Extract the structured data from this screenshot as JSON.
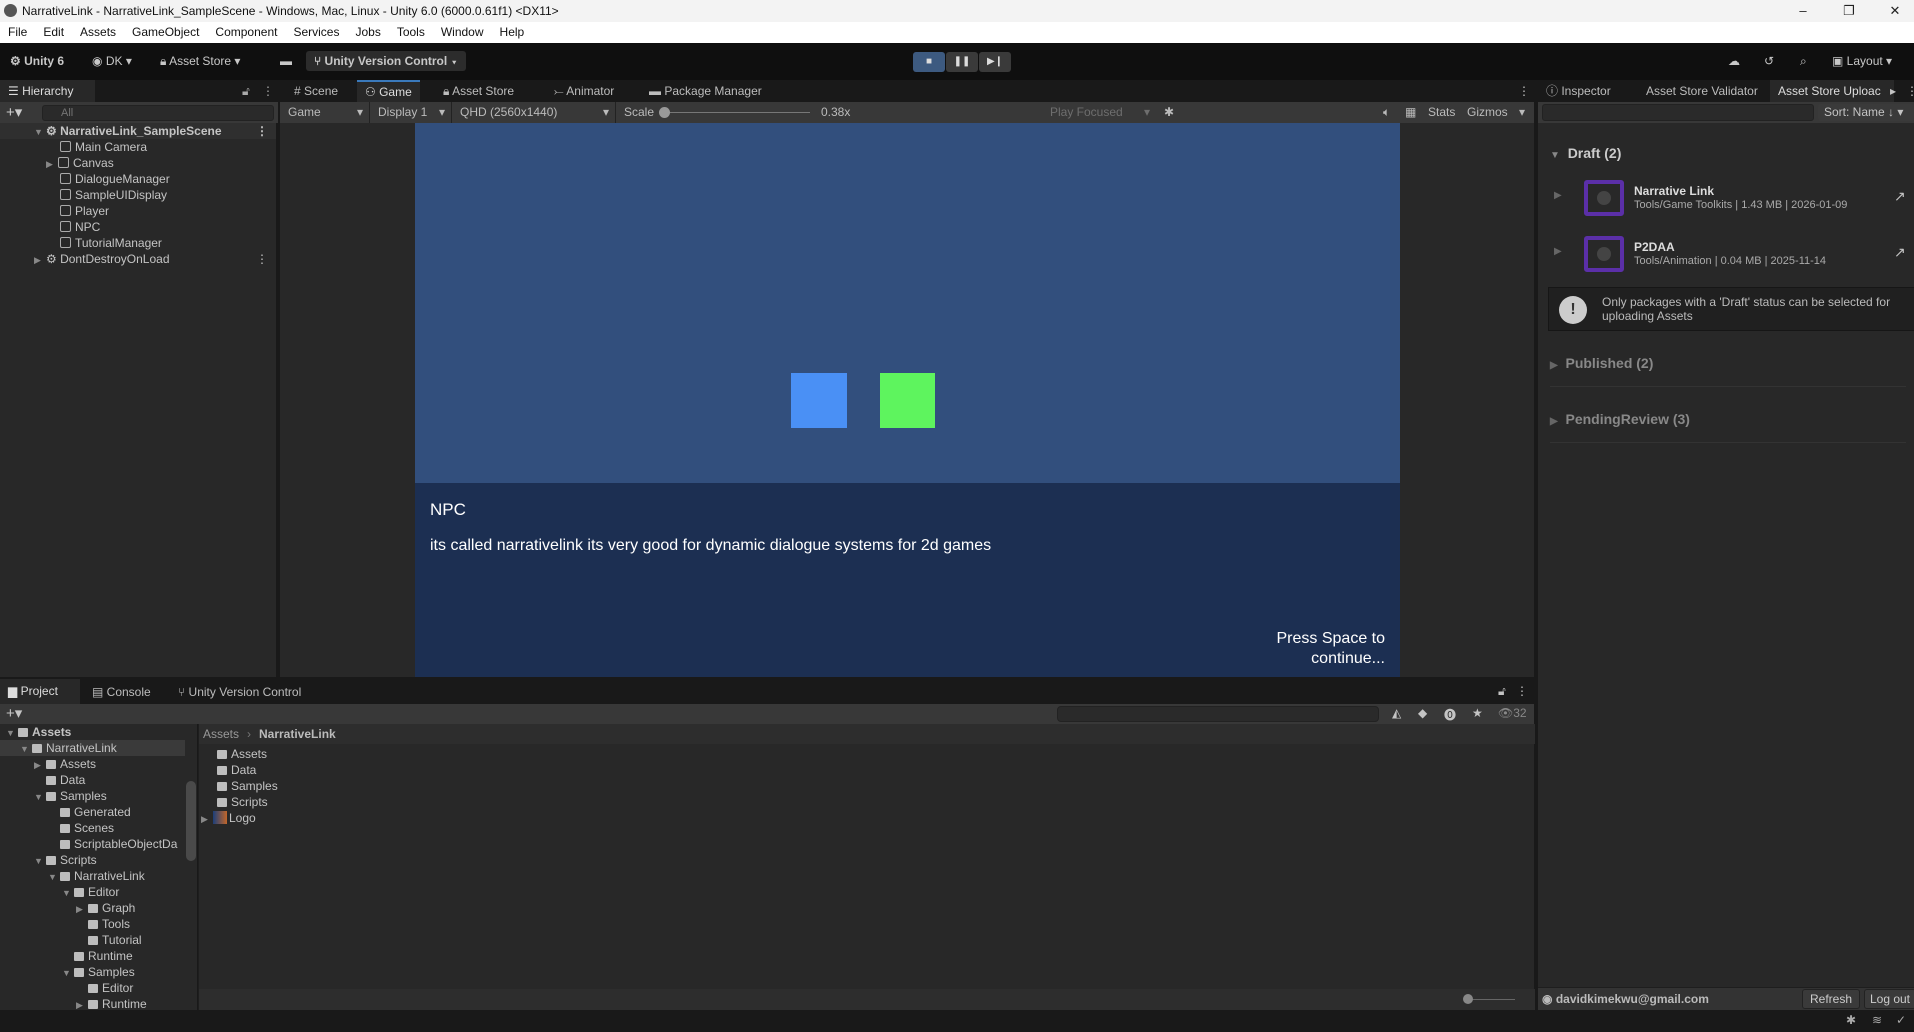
{
  "window": {
    "title": "NarrativeLink - NarrativeLink_SampleScene - Windows, Mac, Linux - Unity 6.0 (6000.0.61f1) <DX11>"
  },
  "menu": [
    "File",
    "Edit",
    "Assets",
    "GameObject",
    "Component",
    "Services",
    "Jobs",
    "Tools",
    "Window",
    "Help"
  ],
  "toolbar": {
    "unity": "Unity 6",
    "account": "DK",
    "asset_store": "Asset Store",
    "version_control": "Unity Version Control",
    "layout": "Layout"
  },
  "hierarchy": {
    "tab": "Hierarchy",
    "search_placeholder": "All",
    "scene": "NarrativeLink_SampleScene",
    "items": [
      "Main Camera",
      "Canvas",
      "DialogueManager",
      "SampleUIDisplay",
      "Player",
      "NPC",
      "TutorialManager"
    ],
    "ddol": "DontDestroyOnLoad"
  },
  "center_tabs": [
    "Scene",
    "Game",
    "Asset Store",
    "Animator",
    "Package Manager"
  ],
  "game_bar": {
    "mode": "Game",
    "display": "Display 1",
    "resolution": "QHD (2560x1440)",
    "scale_label": "Scale",
    "scale_value": "0.38x",
    "play_focused": "Play Focused",
    "stats": "Stats",
    "gizmos": "Gizmos"
  },
  "game": {
    "bg": "#324f7d",
    "dialog_bg": "#1c2f52",
    "blue": "#4a90f5",
    "green": "#5ef45e",
    "speaker": "NPC",
    "line": "its called narrativelink its very good for dynamic dialogue systems for 2d games",
    "prompt_1": "Press Space to",
    "prompt_2": "continue..."
  },
  "right_tabs": [
    "Inspector",
    "Asset Store Validator",
    "Asset Store Uploac"
  ],
  "uploader": {
    "sort": "Sort: Name ↓",
    "draft": "Draft (2)",
    "packages": [
      {
        "name": "Narrative Link",
        "meta": "Tools/Game Toolkits | 1.43 MB | 2026-01-09"
      },
      {
        "name": "P2DAA",
        "meta": "Tools/Animation | 0.04 MB | 2025-11-14"
      }
    ],
    "notice_1": "Only packages with a 'Draft' status can be selected for",
    "notice_2": "uploading Assets",
    "published": "Published (2)",
    "pending": "PendingReview (3)",
    "email": "davidkimekwu@gmail.com",
    "refresh": "Refresh",
    "logout": "Log out"
  },
  "bottom_tabs": [
    "Project",
    "Console",
    "Unity Version Control"
  ],
  "project": {
    "hidden_count": "32",
    "tree": [
      {
        "label": "Assets",
        "d": 0,
        "open": true,
        "bold": true
      },
      {
        "label": "NarrativeLink",
        "d": 1,
        "open": true,
        "sel": true
      },
      {
        "label": "Assets",
        "d": 2,
        "closed": true
      },
      {
        "label": "Data",
        "d": 2
      },
      {
        "label": "Samples",
        "d": 2,
        "open": true
      },
      {
        "label": "Generated",
        "d": 3
      },
      {
        "label": "Scenes",
        "d": 3
      },
      {
        "label": "ScriptableObjectDa",
        "d": 3
      },
      {
        "label": "Scripts",
        "d": 2,
        "open": true
      },
      {
        "label": "NarrativeLink",
        "d": 3,
        "open": true
      },
      {
        "label": "Editor",
        "d": 4,
        "open": true
      },
      {
        "label": "Graph",
        "d": 5,
        "closed": true
      },
      {
        "label": "Tools",
        "d": 5
      },
      {
        "label": "Tutorial",
        "d": 5
      },
      {
        "label": "Runtime",
        "d": 4
      },
      {
        "label": "Samples",
        "d": 4,
        "open": true
      },
      {
        "label": "Editor",
        "d": 5
      },
      {
        "label": "Runtime",
        "d": 5,
        "closed": true
      }
    ],
    "breadcrumb": [
      "Assets",
      "NarrativeLink"
    ],
    "files": [
      "Assets",
      "Data",
      "Samples",
      "Scripts",
      "Logo"
    ]
  }
}
